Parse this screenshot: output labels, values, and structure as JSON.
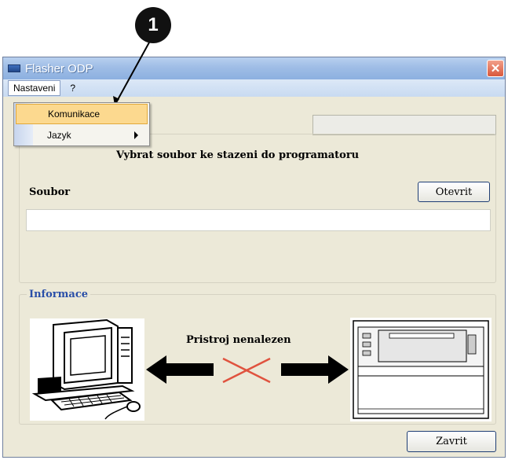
{
  "callout": {
    "number": "1"
  },
  "window": {
    "title": "Flasher ODP",
    "close_symbol": "✕"
  },
  "menubar": {
    "items": [
      {
        "label": "Nastaveni"
      },
      {
        "label": "?"
      }
    ]
  },
  "dropdown": {
    "items": [
      {
        "label": "Komunikace"
      },
      {
        "label": "Jazyk"
      }
    ]
  },
  "main": {
    "subtitle": "Vybrat soubor ke stazeni do programatoru",
    "file_label": "Soubor",
    "open_button": "Otevrit",
    "file_path": ""
  },
  "info": {
    "legend": "Informace",
    "status": "Pristroj nenalezen"
  },
  "footer": {
    "close_button": "Zavrit"
  },
  "colors": {
    "accent": "#2a4fa8",
    "error_cross": "#e0533f",
    "menu_highlight": "#fcd98f"
  },
  "icons": [
    "computer-icon",
    "device-icon",
    "double-arrow-icon",
    "cross-icon",
    "window-icon",
    "close-icon",
    "submenu-arrow-icon"
  ]
}
